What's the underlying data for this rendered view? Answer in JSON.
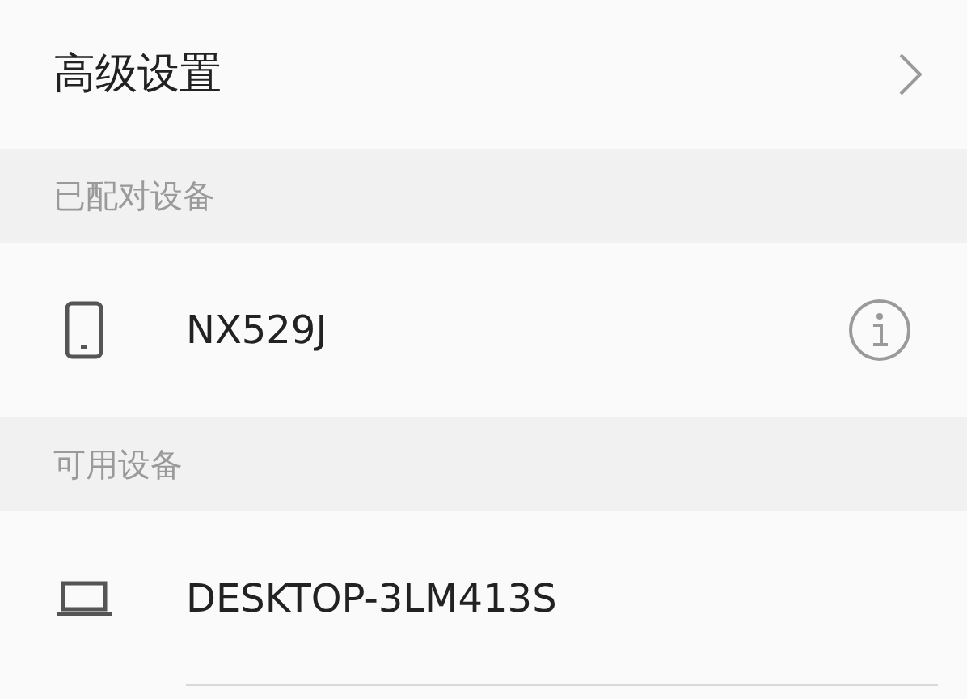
{
  "advanced": {
    "label": "高级设置"
  },
  "sections": [
    {
      "title": "已配对设备",
      "devices": [
        {
          "kind": "phone",
          "name": "NX529J",
          "info": true
        }
      ]
    },
    {
      "title": "可用设备",
      "devices": [
        {
          "kind": "laptop",
          "name": "DESKTOP-3LM413S",
          "info": false
        }
      ]
    }
  ]
}
